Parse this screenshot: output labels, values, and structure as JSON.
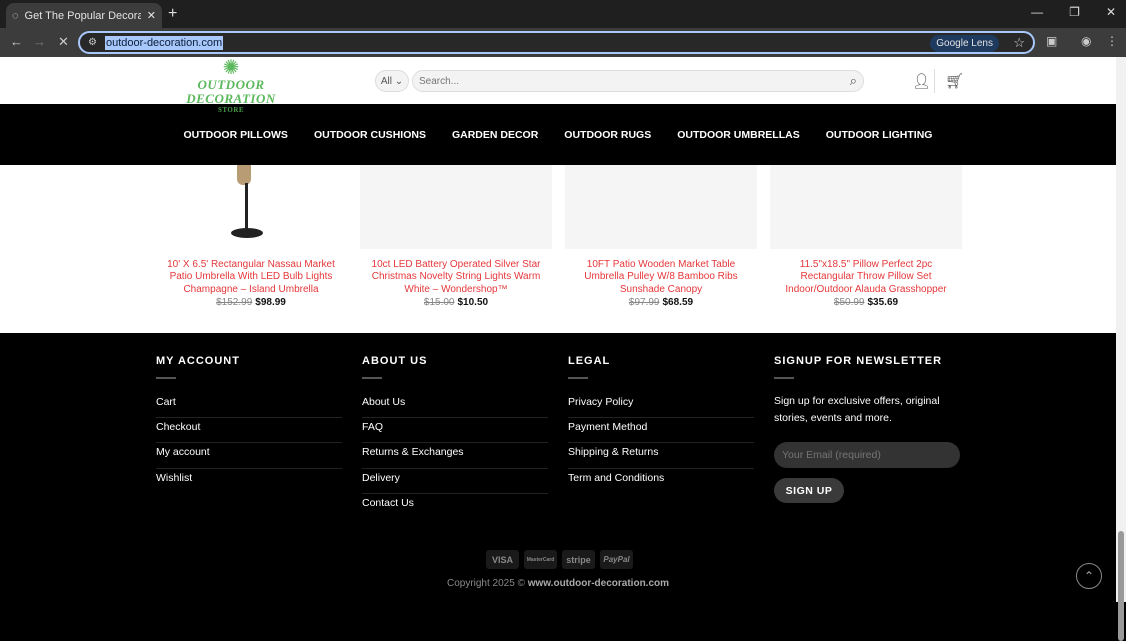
{
  "browser": {
    "tab_title": "Get The Popular Decoration No",
    "url": "outdoor-decoration.com",
    "lens_label": "Google Lens"
  },
  "header": {
    "logo_name": "OUTDOOR DECORATION",
    "logo_sub": "STORE",
    "category_select": "All",
    "search_placeholder": "Search..."
  },
  "nav": [
    "OUTDOOR PILLOWS",
    "OUTDOOR CUSHIONS",
    "GARDEN DECOR",
    "OUTDOOR RUGS",
    "OUTDOOR UMBRELLAS",
    "OUTDOOR LIGHTING"
  ],
  "products": [
    {
      "title": "10' X 6.5' Rectangular Nassau Market Patio Umbrella With LED Bulb Lights Champagne – Island Umbrella",
      "old_price": "$152.99",
      "price": "$98.99"
    },
    {
      "title": "10ct LED Battery Operated Silver Star Christmas Novelty String Lights Warm White – Wondershop™",
      "old_price": "$15.00",
      "price": "$10.50"
    },
    {
      "title": "10FT Patio Wooden Market Table Umbrella Pulley W/8 Bamboo Ribs Sunshade Canopy",
      "old_price": "$97.99",
      "price": "$68.59"
    },
    {
      "title": "11.5\"x18.5\" Pillow Perfect 2pc Rectangular Throw Pillow Set Indoor/Outdoor Alauda Grasshopper",
      "old_price": "$50.99",
      "price": "$35.69"
    }
  ],
  "footer": {
    "my_account": {
      "title": "MY ACCOUNT",
      "links": [
        "Cart",
        "Checkout",
        "My account",
        "Wishlist"
      ]
    },
    "about": {
      "title": "ABOUT US",
      "links": [
        "About Us",
        "FAQ",
        "Returns & Exchanges",
        "Delivery",
        "Contact Us"
      ]
    },
    "legal": {
      "title": "LEGAL",
      "links": [
        "Privacy Policy",
        "Payment Method",
        "Shipping & Returns",
        "Term and Conditions"
      ]
    },
    "newsletter": {
      "title": "SIGNUP FOR NEWSLETTER",
      "text": "Sign up for exclusive offers, original stories, events and more.",
      "email_placeholder": "Your Email (required)",
      "button": "SIGN UP"
    },
    "payments": [
      "VISA",
      "MasterCard",
      "stripe",
      "PayPal"
    ],
    "copyright_prefix": "Copyright 2025 ©",
    "copyright_site": "www.outdoor-decoration.com"
  }
}
